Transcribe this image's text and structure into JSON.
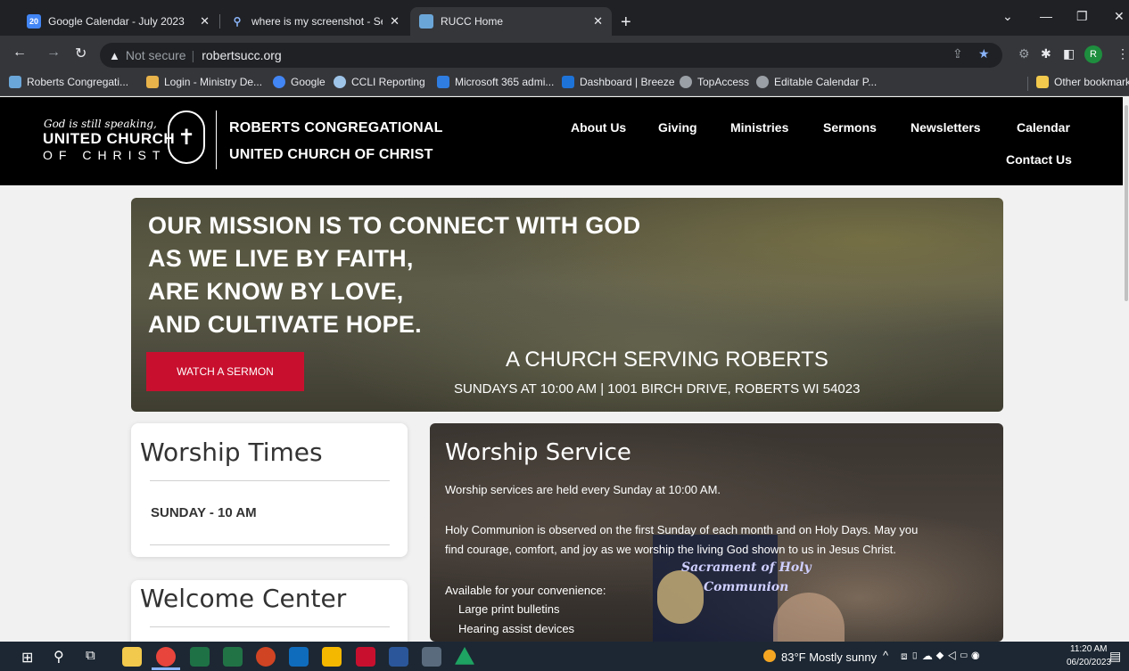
{
  "browser": {
    "tabs": [
      {
        "title": "Google Calendar - July 2023",
        "favicon": "calendar-icon",
        "fav_text": "20",
        "fav_color": "#4285f4",
        "active": false
      },
      {
        "title": "where is my screenshot - Search",
        "favicon": "search-icon",
        "fav_text": "",
        "fav_color": "#1a73e8",
        "active": false
      },
      {
        "title": "RUCC Home",
        "favicon": "page-icon",
        "fav_text": "",
        "fav_color": "#6ba6d8",
        "active": true
      }
    ],
    "new_tab": "+",
    "url": "robertsucc.org",
    "security": "Not secure",
    "profile_initial": "R",
    "bookmarks": [
      {
        "label": "Roberts Congregati...",
        "color": "#6ba6d8"
      },
      {
        "label": "Login - Ministry De...",
        "color": "#e8b34a"
      },
      {
        "label": "Google",
        "color": "#4285f4"
      },
      {
        "label": "CCLI Reporting",
        "color": "#9ec4e8"
      },
      {
        "label": "Microsoft 365 admi...",
        "color": "#2f7de1"
      },
      {
        "label": "Dashboard | Breeze",
        "color": "#1e73d8"
      },
      {
        "label": "TopAccess",
        "color": "#9aa0a6"
      },
      {
        "label": "Editable Calendar P...",
        "color": "#9aa0a6"
      }
    ],
    "other_bookmarks": "Other bookmarks"
  },
  "site": {
    "logo": {
      "script": "God is still speaking,",
      "ucc": "UNITED CHURCH",
      "ofchrist": "OF CHRIST"
    },
    "name_line1": "ROBERTS CONGREGATIONAL",
    "name_line2": "UNITED CHURCH OF CHRIST",
    "nav": [
      "About Us",
      "Giving",
      "Ministries",
      "Sermons",
      "Newsletters",
      "Calendar",
      "Contact Us"
    ],
    "hero": {
      "lines": [
        "OUR MISSION IS TO CONNECT WITH GOD",
        "AS WE LIVE BY FAITH,",
        "ARE KNOW BY LOVE,",
        "AND CULTIVATE HOPE."
      ],
      "button": "WATCH A SERMON",
      "sub1": "A CHURCH SERVING ROBERTS",
      "sub2": "SUNDAYS AT 10:00 AM  |  1001 BIRCH DRIVE, ROBERTS WI  54023"
    },
    "worship_times": {
      "title": "Worship Times",
      "item": "SUNDAY - 10 AM"
    },
    "welcome_center": {
      "title": "Welcome Center"
    },
    "worship_service": {
      "title": "Worship Service",
      "p1": "Worship services are held every Sunday at 10:00 AM.",
      "p2a": "Holy Communion is observed on the first Sunday of each month and on Holy Days.  May you",
      "p2b": "find courage, comfort, and joy as we worship the living God shown to us in Jesus Christ.",
      "p3": "Available for your convenience:",
      "items": [
        "Large print bulletins",
        "Hearing assist devices"
      ],
      "image_text_1": "Sacrament of Holy",
      "image_text_2": "Communion"
    }
  },
  "taskbar": {
    "weather": "83°F  Mostly sunny",
    "time": "11:20 AM",
    "date": "06/20/2023"
  }
}
